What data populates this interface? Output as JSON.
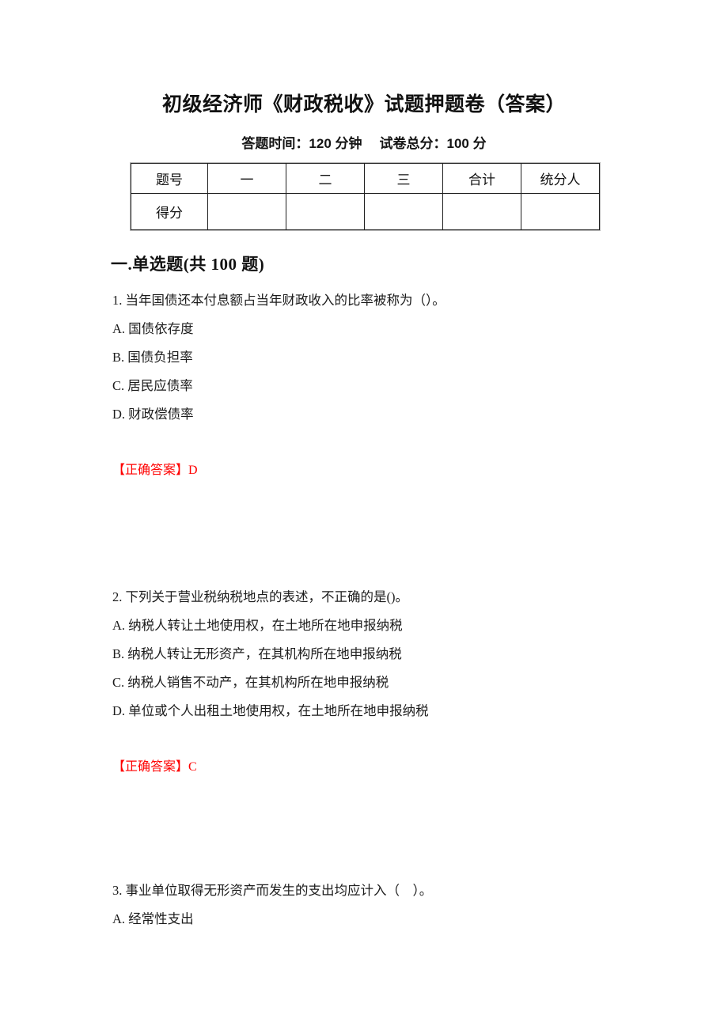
{
  "document": {
    "title": "初级经济师《财政税收》试题押题卷（答案）",
    "subtitle_time": "答题时间：120 分钟",
    "subtitle_total": "试卷总分：100 分"
  },
  "score_table": {
    "header": [
      "题号",
      "一",
      "二",
      "三",
      "合计",
      "统分人"
    ],
    "rows": [
      {
        "label": "得分",
        "cells": [
          "",
          "",
          "",
          "",
          ""
        ]
      }
    ]
  },
  "section": {
    "heading": "一.单选题(共 100 题)"
  },
  "questions": [
    {
      "stem": "1. 当年国债还本付息额占当年财政收入的比率被称为（）。",
      "options": [
        "A. 国债依存度",
        "B. 国债负担率",
        "C. 居民应债率",
        "D. 财政偿债率"
      ],
      "answer": "【正确答案】D"
    },
    {
      "stem": "2. 下列关于营业税纳税地点的表述，不正确的是()。",
      "options": [
        "A. 纳税人转让土地使用权，在土地所在地申报纳税",
        "B. 纳税人转让无形资产，在其机构所在地申报纳税",
        "C. 纳税人销售不动产，在其机构所在地申报纳税",
        "D. 单位或个人出租土地使用权，在土地所在地申报纳税"
      ],
      "answer": "【正确答案】C"
    },
    {
      "stem": "3. 事业单位取得无形资产而发生的支出均应计入（　）。",
      "options": [
        "A. 经常性支出"
      ],
      "answer": ""
    }
  ],
  "colors": {
    "answer_red": "#ff0000",
    "text": "#1c1c1c",
    "table_border": "#1f1f1f"
  }
}
